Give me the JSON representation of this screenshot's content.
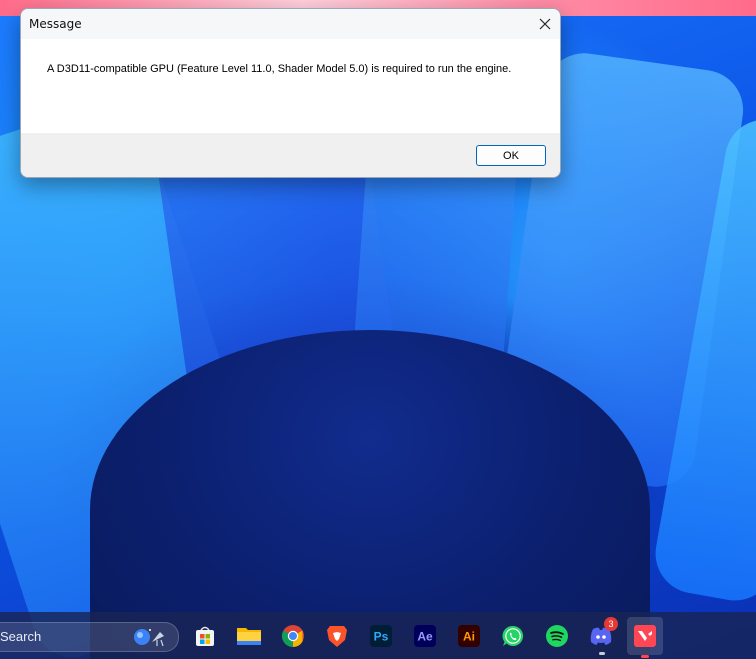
{
  "dialog": {
    "title": "Message",
    "message": "A D3D11-compatible GPU (Feature Level 11.0, Shader Model 5.0) is required to run the engine.",
    "ok_label": "OK"
  },
  "taskbar": {
    "search_label": "Search",
    "apps": [
      {
        "name": "Microsoft Store",
        "icon": "store-icon"
      },
      {
        "name": "File Explorer",
        "icon": "folder-icon"
      },
      {
        "name": "Google Chrome",
        "icon": "chrome-icon"
      },
      {
        "name": "Brave",
        "icon": "brave-icon"
      },
      {
        "name": "Photoshop",
        "icon": "photoshop-icon",
        "text": "Ps"
      },
      {
        "name": "After Effects",
        "icon": "after-effects-icon",
        "text": "Ae"
      },
      {
        "name": "Illustrator",
        "icon": "illustrator-icon",
        "text": "Ai"
      },
      {
        "name": "WhatsApp",
        "icon": "whatsapp-icon"
      },
      {
        "name": "Spotify",
        "icon": "spotify-icon"
      },
      {
        "name": "Discord",
        "icon": "discord-icon",
        "badge": "3"
      },
      {
        "name": "Valorant",
        "icon": "valorant-icon"
      }
    ]
  },
  "colors": {
    "dialog_button_border": "#0067c0",
    "taskbar": "#182456",
    "badge": "#e53935"
  }
}
